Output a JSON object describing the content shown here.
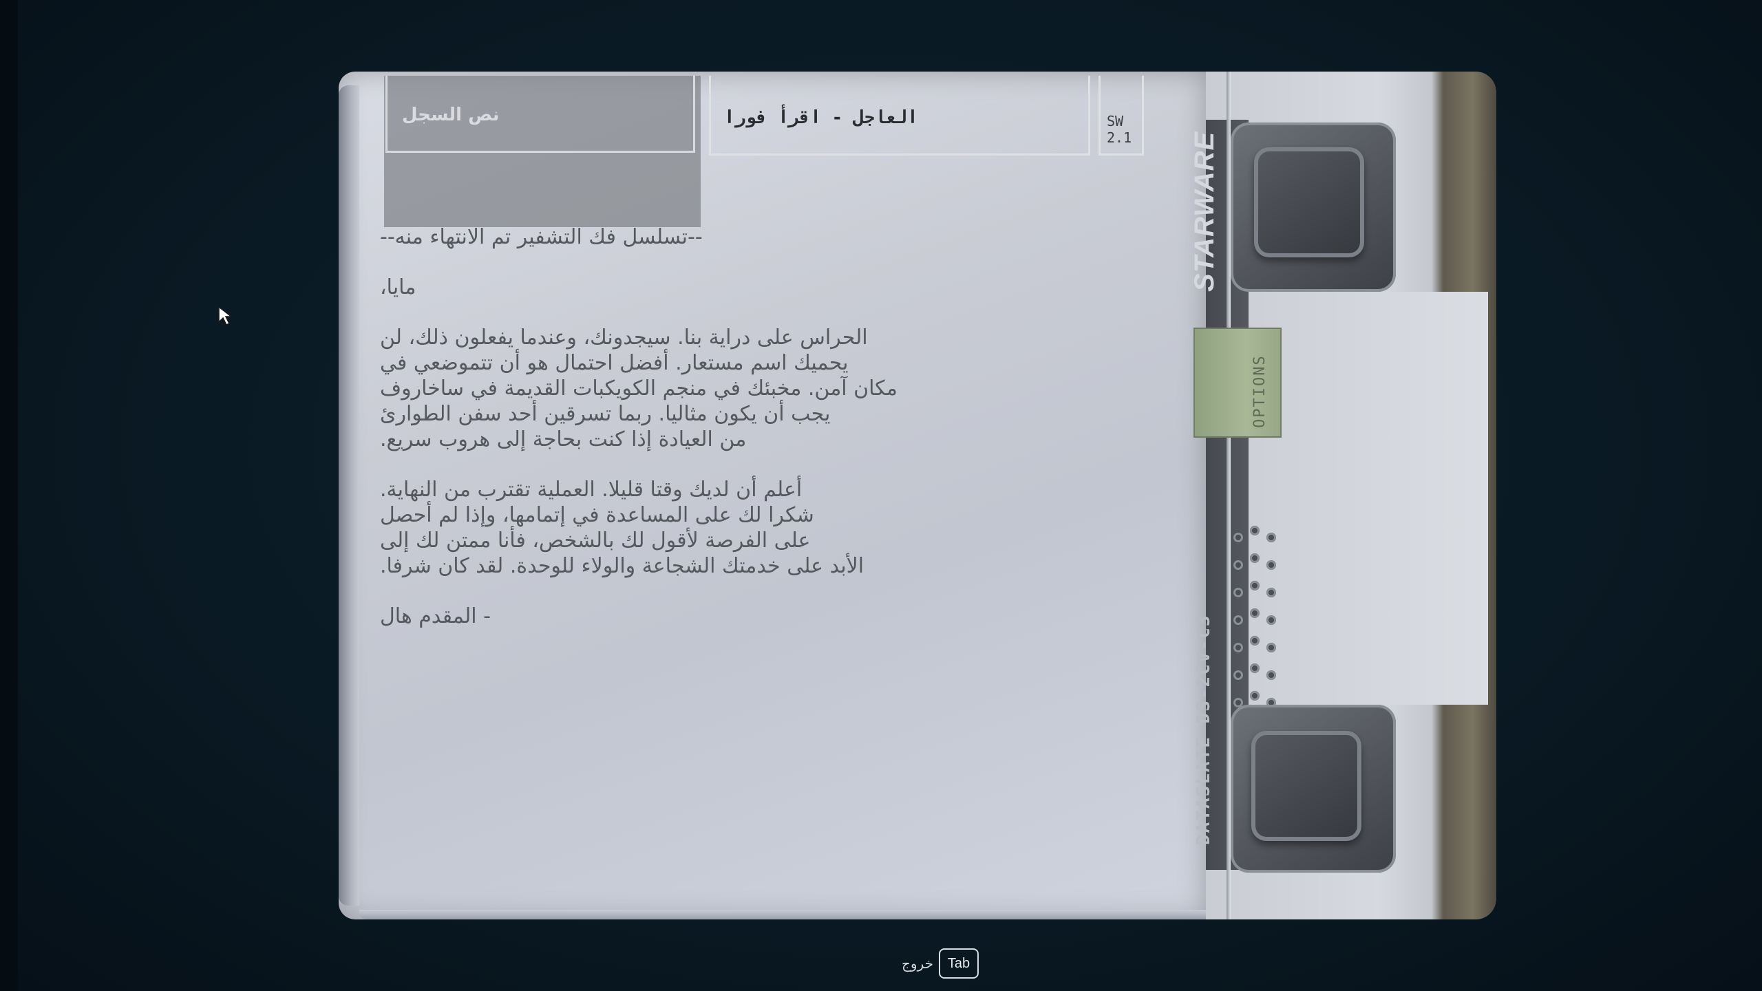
{
  "header": {
    "active_tab_label": "نص السجل",
    "subject_label": "العاجل - اقرأ فورا",
    "version_badge": "SW\n2.1"
  },
  "message": {
    "paragraphs": [
      "--تسلسل فك التشفير تم الانتهاء منه--",
      "مايا،",
      "الحراس على دراية بنا. سيجدونك، وعندما يفعلون ذلك، لن\nيحميك اسم مستعار. أفضل احتمال هو أن تتموضعي في\nمكان آمن. مخبئك في منجم الكويكبات القديمة في ساخاروف\nيجب أن يكون مثاليا. ربما تسرقين أحد سفن الطوارئ\nمن العيادة إذا كنت بحاجة إلى هروب سريع.",
      "أعلم أن لديك وقتا قليلا. العملية تقترب من النهاية.\nشكرا لك على المساعدة في إتمامها، وإذا لم أحصل\nعلى الفرصة لأقول لك بالشخص، فأنا ممتن لك إلى\nالأبد على خدمتك الشجاعة والولاء للوحدة. لقد كان شرفا.",
      "- المقدم هال"
    ]
  },
  "device": {
    "brand": "STARWARE",
    "model": "DATASLATE DS-2CV-C3",
    "options_label": "OPTIONS"
  },
  "footer": {
    "key": "Tab",
    "action": "خروج"
  },
  "colors": {
    "background": "#0a1a24",
    "slate": "#c9ccd4",
    "options_button": "#a9b897"
  },
  "icons": {
    "cursor": "mouse-pointer-icon"
  }
}
